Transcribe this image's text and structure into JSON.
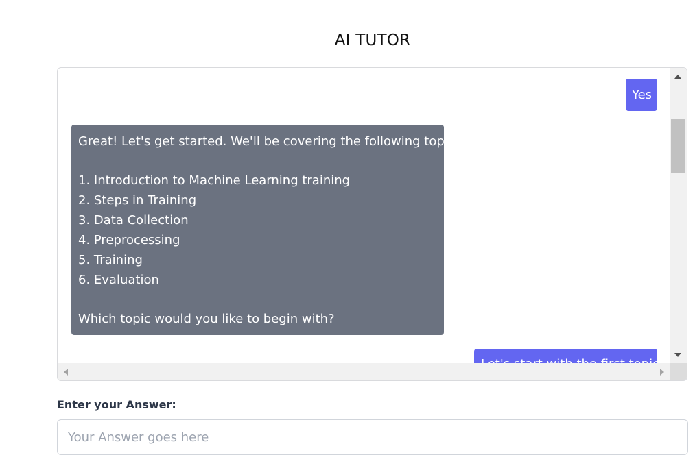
{
  "header": {
    "title": "AI TUTOR"
  },
  "chat": {
    "messages": [
      {
        "role": "user",
        "text": "Yes"
      },
      {
        "role": "bot",
        "lines": [
          "Great! Let's get started. We'll be covering the following topics:",
          "",
          "1. Introduction to Machine Learning training",
          "2. Steps in Training",
          "3. Data Collection",
          "4. Preprocessing",
          "5. Training",
          "6. Evaluation",
          "",
          "Which topic would you like to begin with?"
        ]
      },
      {
        "role": "user",
        "text": "Let's start with the first topics"
      }
    ]
  },
  "answer": {
    "label": "Enter your Answer:",
    "placeholder": "Your Answer goes here",
    "value": ""
  },
  "colors": {
    "user_bubble": "#6366f1",
    "bot_bubble": "#6b7280"
  }
}
